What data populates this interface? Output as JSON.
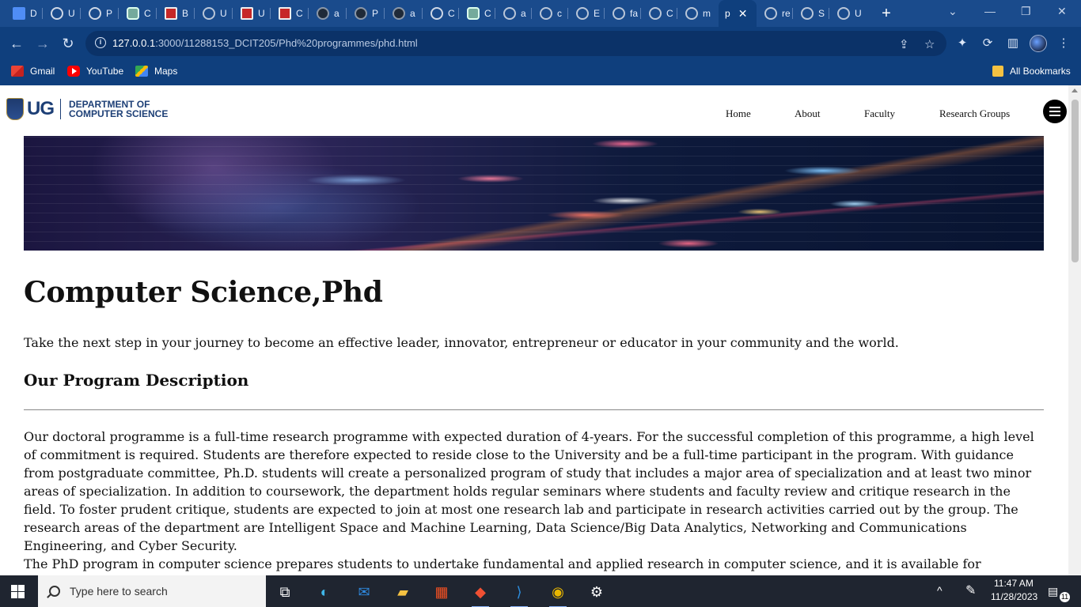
{
  "browser": {
    "tabs": [
      {
        "label": "D",
        "icon": "docs-icon"
      },
      {
        "label": "U",
        "icon": "loading-icon"
      },
      {
        "label": "P",
        "icon": "loading-icon"
      },
      {
        "label": "C",
        "icon": "chatgpt-icon"
      },
      {
        "label": "B",
        "icon": "red-logo-icon"
      },
      {
        "label": "U",
        "icon": "circle-logo-icon"
      },
      {
        "label": "U",
        "icon": "red-logo-icon"
      },
      {
        "label": "C",
        "icon": "red-square-icon"
      },
      {
        "label": "a",
        "icon": "github-icon"
      },
      {
        "label": "P",
        "icon": "github-icon"
      },
      {
        "label": "a",
        "icon": "github-icon"
      },
      {
        "label": "C",
        "icon": "loading-icon"
      },
      {
        "label": "C",
        "icon": "chatgpt-icon"
      },
      {
        "label": "a",
        "icon": "globe-icon"
      },
      {
        "label": "c",
        "icon": "globe-icon"
      },
      {
        "label": "E",
        "icon": "globe-icon"
      },
      {
        "label": "fa",
        "icon": "globe-icon"
      },
      {
        "label": "C",
        "icon": "globe-icon"
      },
      {
        "label": "m",
        "icon": "globe-icon"
      },
      {
        "label": "p",
        "icon": "none",
        "active": true
      },
      {
        "label": "re",
        "icon": "globe-icon"
      },
      {
        "label": "S",
        "icon": "globe-icon"
      },
      {
        "label": "U",
        "icon": "globe-icon"
      }
    ],
    "url_host": "127.0.0.1",
    "url_path": ":3000/11288153_DCIT205/Phd%20programmes/phd.html",
    "bookmarks": [
      {
        "label": "Gmail",
        "icon": "gmail-icon"
      },
      {
        "label": "YouTube",
        "icon": "youtube-icon"
      },
      {
        "label": "Maps",
        "icon": "maps-icon"
      }
    ],
    "all_bookmarks": "All Bookmarks",
    "colors": {
      "frame": "#0f3f7d",
      "tabstrip": "#1a4b8c"
    }
  },
  "site": {
    "logo_ug": "UG",
    "dept_line1": "DEPARTMENT OF",
    "dept_line2": "COMPUTER SCIENCE",
    "nav": [
      "Home",
      "About",
      "Faculty",
      "Research Groups"
    ]
  },
  "main": {
    "title": "Computer Science,Phd",
    "tagline": "Take the next step in your journey to become an effective leader, innovator, entrepreneur or educator in your community and the world.",
    "section_title": "Our Program Description",
    "paragraph1": "Our doctoral programme is a full-time research programme with expected duration of 4-years. For the successful completion of this programme, a high level of commitment is required. Students are therefore expected to reside close to the University and be a full-time participant in the program. With guidance from postgraduate committee, Ph.D. students will create a personalized program of study that includes a major area of specialization and at least two minor areas of specialization. In addition to coursework, the department holds regular seminars where students and faculty review and critique research in the field. To foster prudent critique, students are expected to join at most one research lab and participate in research activities carried out by the group. The research areas of the department are Intelligent Space and Machine Learning, Data Science/Big Data Analytics, Networking and Communications Engineering, and Cyber Security.",
    "paragraph2": "The PhD program in computer science prepares students to undertake fundamental and applied research in computer science, and it is available for"
  },
  "taskbar": {
    "search_placeholder": "Type here to search",
    "time": "11:47 AM",
    "date": "11/28/2023",
    "notification_count": "11"
  }
}
